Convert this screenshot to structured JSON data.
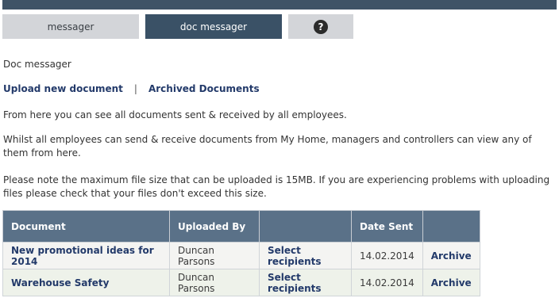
{
  "tabs": {
    "messager": "messager",
    "doc_messager": "doc messager",
    "help_icon": "?"
  },
  "page": {
    "heading": "Doc messager",
    "upload_link": "Upload new document",
    "separator": "|",
    "archived_link": "Archived Documents",
    "para1": "From here you can see all documents sent & received by all employees.",
    "para2": "Whilst all employees can send & receive documents from My Home, managers and controllers can view any of them from here.",
    "para3": "Please note the maximum file size that can be uploaded is 15MB. If you are experiencing problems with uploading files please check that your files don't exceed this size."
  },
  "table": {
    "headers": {
      "document": "Document",
      "uploaded_by": "Uploaded By",
      "actions": "",
      "date_sent": "Date Sent",
      "archive": ""
    },
    "rows": [
      {
        "document": "New promotional ideas for 2014",
        "uploaded_by": "Duncan Parsons",
        "select": "Select recipients",
        "date_sent": "14.02.2014",
        "archive": "Archive"
      },
      {
        "document": "Warehouse Safety",
        "uploaded_by": "Duncan Parsons",
        "select": "Select recipients",
        "date_sent": "14.02.2014",
        "archive": "Archive"
      }
    ]
  },
  "colors": {
    "top_bar": "#3f5366",
    "tab_active": "#3a5166",
    "tab_inactive": "#d3d5d9",
    "table_header": "#5a7188",
    "link": "#233a6a"
  },
  "icons": {
    "help": "question-circle-icon"
  }
}
